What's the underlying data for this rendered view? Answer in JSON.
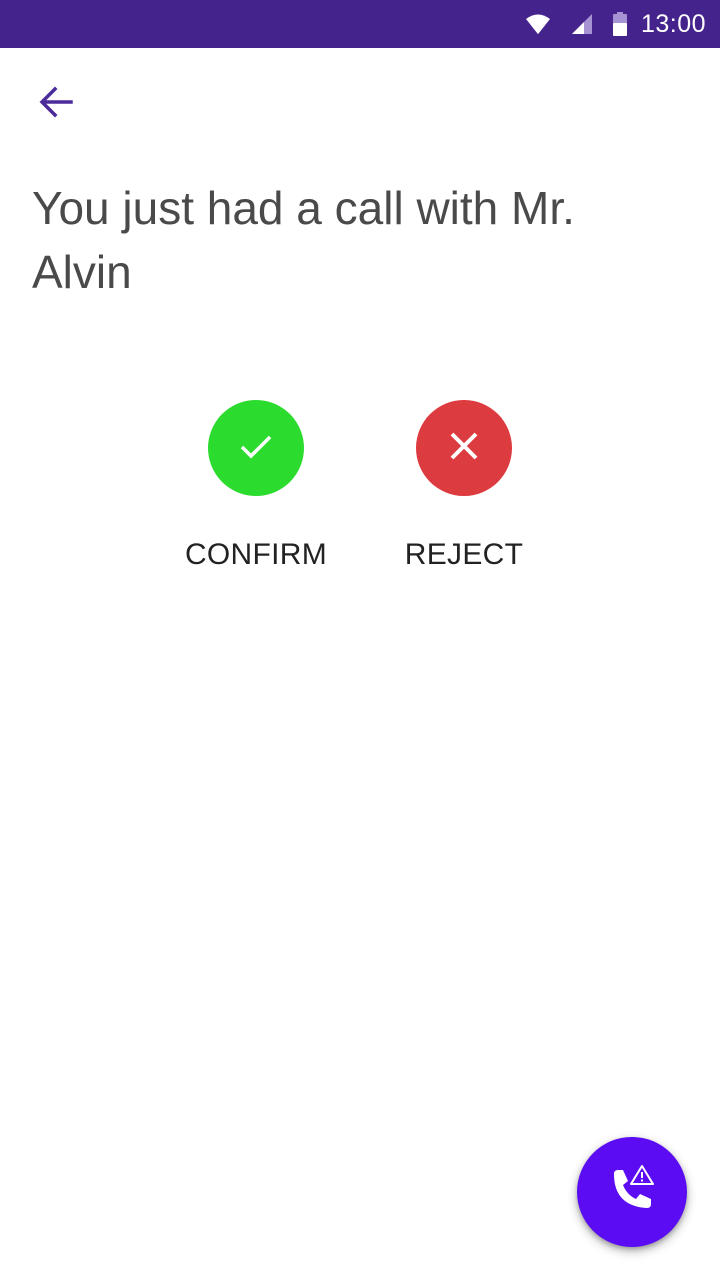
{
  "status_bar": {
    "time": "13:00",
    "icons": [
      "wifi-icon",
      "cell-signal-icon",
      "battery-icon"
    ],
    "background": "#45238c"
  },
  "header": {
    "back_icon": "arrow-back-icon",
    "accent": "#4b2a9a"
  },
  "main": {
    "title": "You just had a call with Mr. Alvin",
    "actions": [
      {
        "label": "CONFIRM",
        "icon": "check-icon",
        "color": "#2bdc2f"
      },
      {
        "label": "REJECT",
        "icon": "close-icon",
        "color": "#dc3b3f"
      }
    ]
  },
  "fab": {
    "icon": "phone-alert-icon",
    "color": "#5b0cf2"
  }
}
